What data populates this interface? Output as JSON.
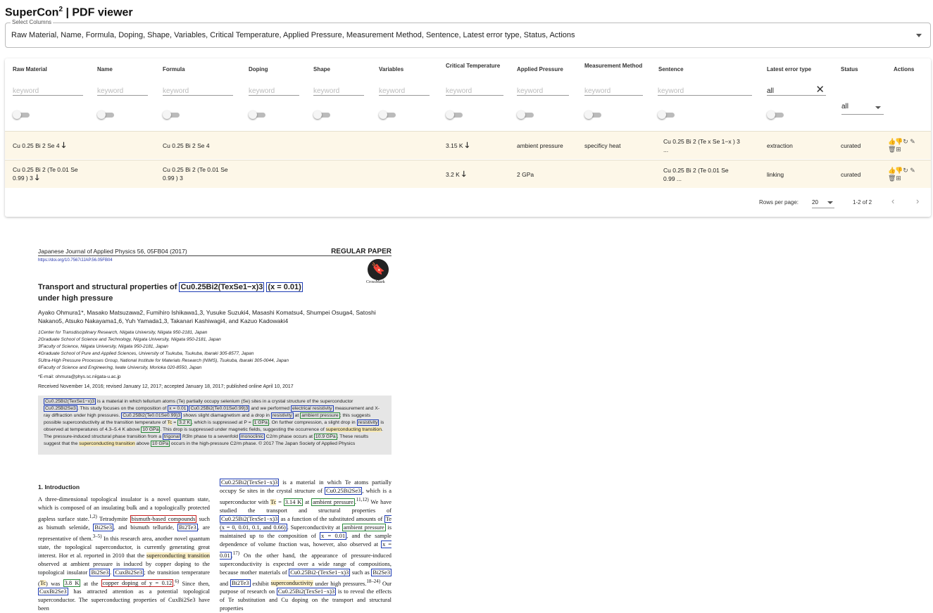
{
  "app": {
    "title": "SuperCon",
    "title_sup": "2",
    "title_rest": " | PDF viewer"
  },
  "columns_select": {
    "legend": "Select Columns",
    "value": "Raw Material, Name, Formula, Doping, Shape, Variables, Critical Temperature, Applied Pressure, Measurement Method, Sentence, Latest error type, Status, Actions"
  },
  "table": {
    "headers": [
      "Raw Material",
      "Name",
      "Formula",
      "Doping",
      "Shape",
      "Variables",
      "Critical Temperature",
      "Applied Pressure",
      "Measurement Method",
      "Sentence",
      "Latest error type",
      "Status",
      "Actions"
    ],
    "filter_placeholder": "keyword",
    "error_type_filter": "all",
    "status_filter": "all",
    "rows": [
      {
        "raw_material": "Cu 0.25 Bi 2 Se 4",
        "raw_material_2": "",
        "formula": "Cu 0.25 Bi 2 Se 4",
        "formula_2": "",
        "tc": "3.15 K",
        "pressure": "ambient pressure",
        "method": "specificy heat",
        "sentence": "Cu 0.25 Bi 2 (Te x Se 1−x ) 3",
        "sentence_2": "...",
        "error_type": "extraction",
        "status": "curated"
      },
      {
        "raw_material": "Cu 0.25 Bi 2 (Te 0.01 Se",
        "raw_material_2": "0.99 ) 3",
        "formula": "Cu 0.25 Bi 2 (Te 0.01 Se",
        "formula_2": "0.99 ) 3",
        "tc": "3.2 K",
        "pressure": "2 GPa",
        "method": "",
        "sentence": "Cu 0.25 Bi 2 (Te 0.01 Se",
        "sentence_2": "0.99 ...",
        "error_type": "linking",
        "status": "curated"
      }
    ],
    "footer": {
      "rows_per_page_label": "Rows per page:",
      "rows_per_page": "20",
      "range": "1-2 of 2"
    }
  },
  "pdf": {
    "journal": "Japanese Journal of Applied Physics 56, 05FB04 (2017)",
    "paper_type": "REGULAR PAPER",
    "doi": "https://doi.org/10.7567/JJAP.56.05FB04",
    "crossmark": "CrossMark",
    "title_a": "Transport and structural properties of",
    "title_formula": "Cu0.25Bi2(TexSe1−x)3",
    "title_x": "(x = 0.01)",
    "title_b": "under high pressure",
    "authors": "Ayako Ohmura1*, Masako Matsuzawa2, Fumihiro Ishikawa1,3, Yusuke Suzuki4, Masashi Komatsu4, Shumpei Osuga4, Satoshi Nakano5, Atsuko Nakayama1,6, Yuh Yamada1,3, Takanari Kashiwagi4, and Kazuo Kadowaki4",
    "affiliations": [
      "1Center for Transdisciplinary Research, Niigata University, Niigata 950-2181, Japan",
      "2Graduate School of Science and Technology, Niigata University, Niigata 950-2181, Japan",
      "3Faculty of Science, Niigata University, Niigata 950-2181, Japan",
      "4Graduate School of Pure and Applied Sciences, University of Tsukuba, Tsukuba, Ibaraki 305-8577, Japan",
      "5Ultra-High Pressure Processes Group, National Institute for Materials Research (NIMS), Tsukuba, Ibaraki 305-0044, Japan",
      "6Faculty of Science and Engineering, Iwate University, Morioka 020-8550, Japan"
    ],
    "email": "*E-mail: ohmura@phys.sc.niigata-u.ac.jp",
    "received": "Received November 14, 2016; revised January 12, 2017; accepted January 18, 2017; published online April 10, 2017",
    "section": "1.  Introduction"
  }
}
